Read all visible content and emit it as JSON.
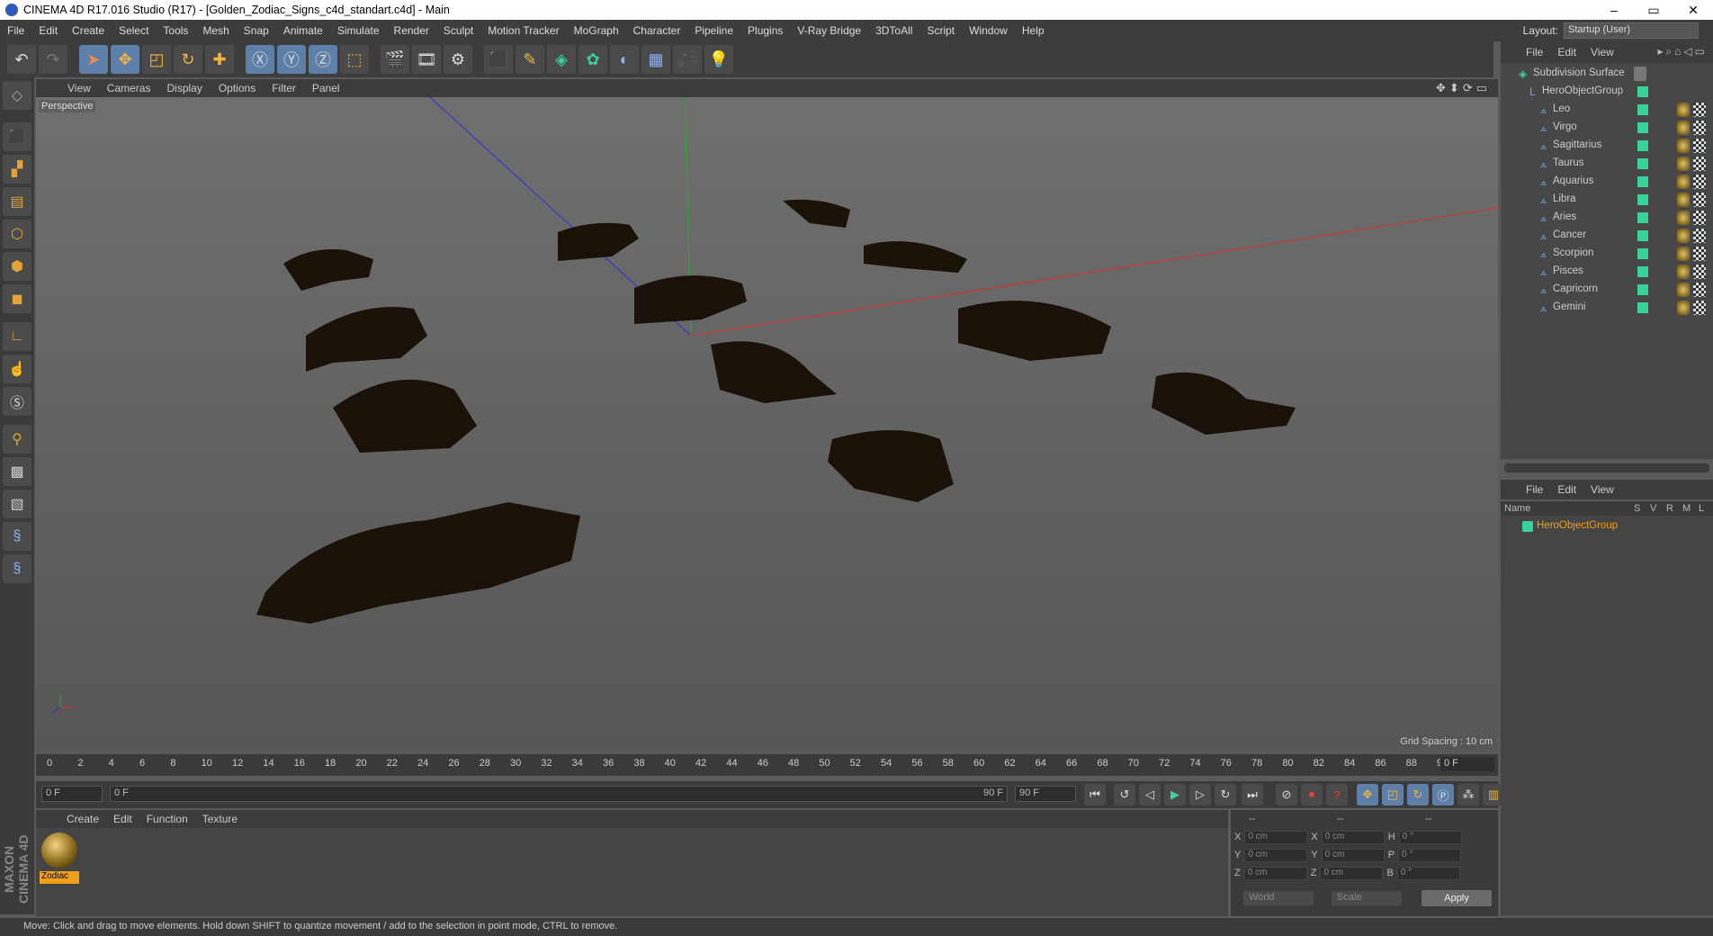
{
  "window": {
    "title": "CINEMA 4D R17.016 Studio (R17) - [Golden_Zodiac_Signs_c4d_standart.c4d] - Main",
    "minimize": "–",
    "maximize": "▭",
    "close": "✕"
  },
  "menubar": {
    "items": [
      "File",
      "Edit",
      "Create",
      "Select",
      "Tools",
      "Mesh",
      "Snap",
      "Animate",
      "Simulate",
      "Render",
      "Sculpt",
      "Motion Tracker",
      "MoGraph",
      "Character",
      "Pipeline",
      "Plugins",
      "V-Ray Bridge",
      "3DToAll",
      "Script",
      "Window",
      "Help"
    ],
    "layout_label": "Layout:",
    "layout_value": "Startup (User)"
  },
  "viewport_menu": {
    "items": [
      "View",
      "Cameras",
      "Display",
      "Options",
      "Filter",
      "Panel"
    ],
    "label": "Perspective",
    "grid_spacing": "Grid Spacing : 10 cm"
  },
  "timeline": {
    "ticks": [
      "0",
      "2",
      "4",
      "6",
      "8",
      "10",
      "12",
      "14",
      "16",
      "18",
      "20",
      "22",
      "24",
      "26",
      "28",
      "30",
      "32",
      "34",
      "36",
      "38",
      "40",
      "42",
      "44",
      "46",
      "48",
      "50",
      "52",
      "54",
      "56",
      "58",
      "60",
      "62",
      "64",
      "66",
      "68",
      "70",
      "72",
      "74",
      "76",
      "78",
      "80",
      "82",
      "84",
      "86",
      "88",
      "90"
    ],
    "current_frame": "0 F"
  },
  "transport": {
    "start": "0 F",
    "range_start": "0 F",
    "range_end": "90 F",
    "end": "90 F"
  },
  "material_menu": {
    "items": [
      "Create",
      "Edit",
      "Function",
      "Texture"
    ],
    "material_name": "Zodiac"
  },
  "coords": {
    "headers": [
      "--",
      "--",
      "--"
    ],
    "rows": [
      {
        "a": "X",
        "v1": "0 cm",
        "b": "X",
        "v2": "0 cm",
        "c": "H",
        "v3": "0 °"
      },
      {
        "a": "Y",
        "v1": "0 cm",
        "b": "Y",
        "v2": "0 cm",
        "c": "P",
        "v3": "0 °"
      },
      {
        "a": "Z",
        "v1": "0 cm",
        "b": "Z",
        "v2": "0 cm",
        "c": "B",
        "v3": "0 °"
      }
    ],
    "world": "World",
    "scale": "Scale",
    "apply": "Apply"
  },
  "object_menu": {
    "items": [
      "File",
      "Edit",
      "View"
    ]
  },
  "objects": {
    "root": "Subdivision Surface",
    "group": "HeroObjectGroup",
    "children": [
      "Leo",
      "Virgo",
      "Sagittarius",
      "Taurus",
      "Aquarius",
      "Libra",
      "Aries",
      "Cancer",
      "Scorpion",
      "Pisces",
      "Capricorn",
      "Gemini"
    ]
  },
  "attr_menu": {
    "items": [
      "File",
      "Edit",
      "View"
    ],
    "headers": {
      "name": "Name",
      "s": "S",
      "v": "V",
      "r": "R",
      "m": "M",
      "l": "L"
    },
    "row": "HeroObjectGroup"
  },
  "status": "Move: Click and drag to move elements. Hold down SHIFT to quantize movement / add to the selection in point mode, CTRL to remove.",
  "maxon": "MAXON CINEMA 4D",
  "colors": {
    "accent": "#f0a01a",
    "select": "#5d7fa8",
    "obj_dot": "#39d39a"
  }
}
